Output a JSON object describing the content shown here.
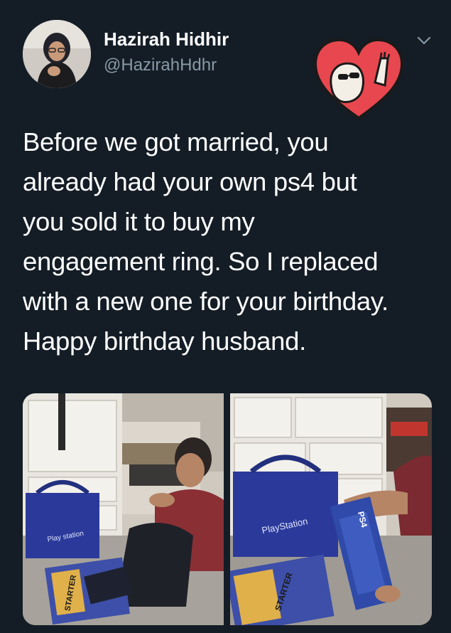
{
  "tweet": {
    "display_name": "Hazirah Hidhir",
    "handle": "@HazirahHdhr",
    "text_lines": [
      "Before we got married, you",
      "already had your own ps4 but",
      "you sold it to buy my",
      "engagement ring. So I replaced",
      "with a new one for your birthday.",
      "Happy birthday husband."
    ]
  },
  "icons": {
    "menu": "chevron-down-icon",
    "sticker": "heart-sticker-icon"
  },
  "colors": {
    "background": "#141d26",
    "text": "#ffffff",
    "secondary_text": "#8899a6",
    "heart": "#e8474f"
  }
}
